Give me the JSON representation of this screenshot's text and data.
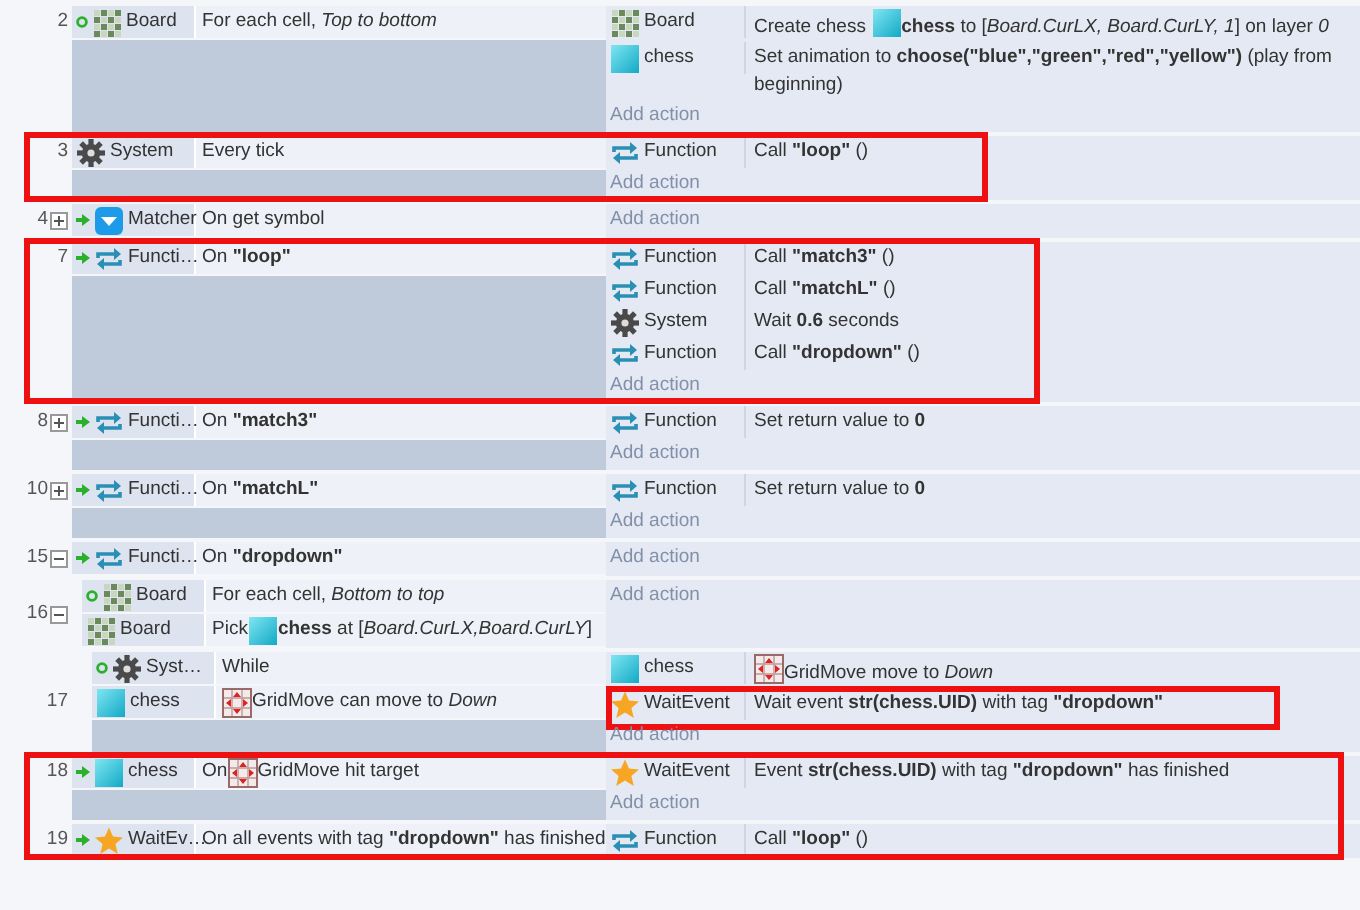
{
  "events": [
    {
      "number": "2",
      "trigger": false,
      "highlight": false,
      "conditions": [
        {
          "object": "Board",
          "kind": "board",
          "loop": true,
          "parts": [
            {
              "kind": "text",
              "text": "For each cell, *Top to bottom*"
            }
          ]
        }
      ],
      "actions": [
        {
          "object": "Board",
          "kind": "board",
          "highlight": false,
          "parts": [
            {
              "kind": "text",
              "text": "Create chess "
            },
            {
              "kind": "object-icon"
            },
            {
              "kind": "text",
              "text": "**chess** to [*Board.CurLX, Board.CurLY, 1*] on layer *0*"
            }
          ]
        },
        {
          "object": "chess",
          "kind": "chess",
          "highlight": false,
          "parts": [
            {
              "kind": "text",
              "text": "Set animation to **choose(\"blue\",\"green\",\"red\",\"yellow\")** (play from beginning)"
            }
          ]
        }
      ],
      "add_action": "Add action"
    },
    {
      "number": "3",
      "trigger": false,
      "highlight": true,
      "conditions": [
        {
          "object": "System",
          "kind": "system",
          "loop": false,
          "parts": [
            {
              "kind": "text",
              "text": "Every tick"
            }
          ]
        }
      ],
      "actions": [
        {
          "object": "Function",
          "kind": "function",
          "highlight": false,
          "parts": [
            {
              "kind": "text",
              "text": "Call **\"loop\"** ()"
            }
          ]
        }
      ],
      "add_action": "Add action"
    },
    {
      "number": "4",
      "expanded": false,
      "trigger": true,
      "highlight": false,
      "conditions": [
        {
          "object": "Matcher",
          "kind": "matcher",
          "loop": false,
          "parts": [
            {
              "kind": "text",
              "text": "On get symbol"
            }
          ]
        }
      ],
      "add_action": "Add action"
    },
    {
      "number": "7",
      "trigger": true,
      "highlight": true,
      "conditions": [
        {
          "object": "Functi…",
          "kind": "function",
          "loop": false,
          "parts": [
            {
              "kind": "text",
              "text": "On **\"loop\"**"
            }
          ]
        }
      ],
      "actions": [
        {
          "object": "Function",
          "kind": "function",
          "highlight": false,
          "parts": [
            {
              "kind": "text",
              "text": "Call **\"match3\"** ()"
            }
          ]
        },
        {
          "object": "Function",
          "kind": "function",
          "highlight": false,
          "parts": [
            {
              "kind": "text",
              "text": "Call **\"matchL\"** ()"
            }
          ]
        },
        {
          "object": "System",
          "kind": "system",
          "highlight": false,
          "parts": [
            {
              "kind": "text",
              "text": "Wait **0.6** seconds"
            }
          ]
        },
        {
          "object": "Function",
          "kind": "function",
          "highlight": false,
          "parts": [
            {
              "kind": "text",
              "text": "Call **\"dropdown\"** ()"
            }
          ]
        }
      ],
      "add_action": "Add action"
    },
    {
      "number": "8",
      "expanded": false,
      "trigger": true,
      "highlight": false,
      "conditions": [
        {
          "object": "Functi…",
          "kind": "function",
          "loop": false,
          "parts": [
            {
              "kind": "text",
              "text": "On **\"match3\"**"
            }
          ]
        }
      ],
      "actions": [
        {
          "object": "Function",
          "kind": "function",
          "highlight": false,
          "parts": [
            {
              "kind": "text",
              "text": "Set return value to **0**"
            }
          ]
        }
      ],
      "add_action": "Add action"
    },
    {
      "number": "10",
      "expanded": false,
      "trigger": true,
      "highlight": false,
      "conditions": [
        {
          "object": "Functi…",
          "kind": "function",
          "loop": false,
          "parts": [
            {
              "kind": "text",
              "text": "On **\"matchL\"**"
            }
          ]
        }
      ],
      "actions": [
        {
          "object": "Function",
          "kind": "function",
          "highlight": false,
          "parts": [
            {
              "kind": "text",
              "text": "Set return value to **0**"
            }
          ]
        }
      ],
      "add_action": "Add action"
    },
    {
      "number": "15",
      "expanded": true,
      "trigger": true,
      "highlight": false,
      "conditions": [
        {
          "object": "Functi…",
          "kind": "function",
          "loop": false,
          "parts": [
            {
              "kind": "text",
              "text": "On **\"dropdown\"**"
            }
          ]
        }
      ],
      "add_action": "Add action",
      "children": [
        {
          "number": "16",
          "expanded": true,
          "trigger": false,
          "highlight": false,
          "conditions": [
            {
              "object": "Board",
              "kind": "board",
              "loop": true,
              "parts": [
                {
                  "kind": "text",
                  "text": "For each cell, *Bottom to top*"
                }
              ]
            },
            {
              "object": "Board",
              "kind": "board",
              "loop": false,
              "parts": [
                {
                  "kind": "text",
                  "text": "Pick "
                },
                {
                  "kind": "object-icon"
                },
                {
                  "kind": "text",
                  "text": "**chess** at [*Board.CurLX,Board.CurLY*]"
                }
              ]
            }
          ],
          "add_action": "Add action",
          "children": [
            {
              "number": "17",
              "trigger": false,
              "highlight": false,
              "conditions": [
                {
                  "object": "Syst…",
                  "kind": "system",
                  "loop": true,
                  "parts": [
                    {
                      "kind": "text",
                      "text": "While"
                    }
                  ]
                },
                {
                  "object": "chess",
                  "kind": "chess",
                  "loop": false,
                  "parts": [
                    {
                      "kind": "behavior-icon"
                    },
                    {
                      "kind": "text",
                      "text": "GridMove can move to *Down*"
                    }
                  ]
                }
              ],
              "actions": [
                {
                  "object": "chess",
                  "kind": "chess",
                  "highlight": false,
                  "parts": [
                    {
                      "kind": "behavior-icon"
                    },
                    {
                      "kind": "text",
                      "text": "GridMove move to *Down*"
                    }
                  ]
                },
                {
                  "object": "WaitEvent",
                  "kind": "waitevent",
                  "highlight": true,
                  "parts": [
                    {
                      "kind": "text",
                      "text": "Wait event **str(chess.UID)** with tag **\"dropdown\"**"
                    }
                  ]
                }
              ],
              "add_action": "Add action"
            }
          ]
        }
      ]
    },
    {
      "number": "18",
      "trigger": true,
      "highlight": true,
      "conditions": [
        {
          "object": "chess",
          "kind": "chess",
          "loop": false,
          "parts": [
            {
              "kind": "text",
              "text": "On "
            },
            {
              "kind": "behavior-icon"
            },
            {
              "kind": "text",
              "text": "GridMove hit target"
            }
          ]
        }
      ],
      "actions": [
        {
          "object": "WaitEvent",
          "kind": "waitevent",
          "highlight": false,
          "parts": [
            {
              "kind": "text",
              "text": "Event **str(chess.UID)** with tag **\"dropdown\"** has finished"
            }
          ]
        }
      ],
      "add_action": "Add action"
    },
    {
      "number": "19",
      "trigger": true,
      "highlight": true,
      "conditions": [
        {
          "object": "WaitEv…",
          "kind": "waitevent",
          "loop": false,
          "parts": [
            {
              "kind": "text",
              "text": "On all events with tag **\"dropdown\"** has finished"
            }
          ]
        }
      ],
      "actions": [
        {
          "object": "Function",
          "kind": "function",
          "highlight": false,
          "parts": [
            {
              "kind": "text",
              "text": "Call **\"loop\"** ()"
            }
          ]
        }
      ]
    }
  ]
}
